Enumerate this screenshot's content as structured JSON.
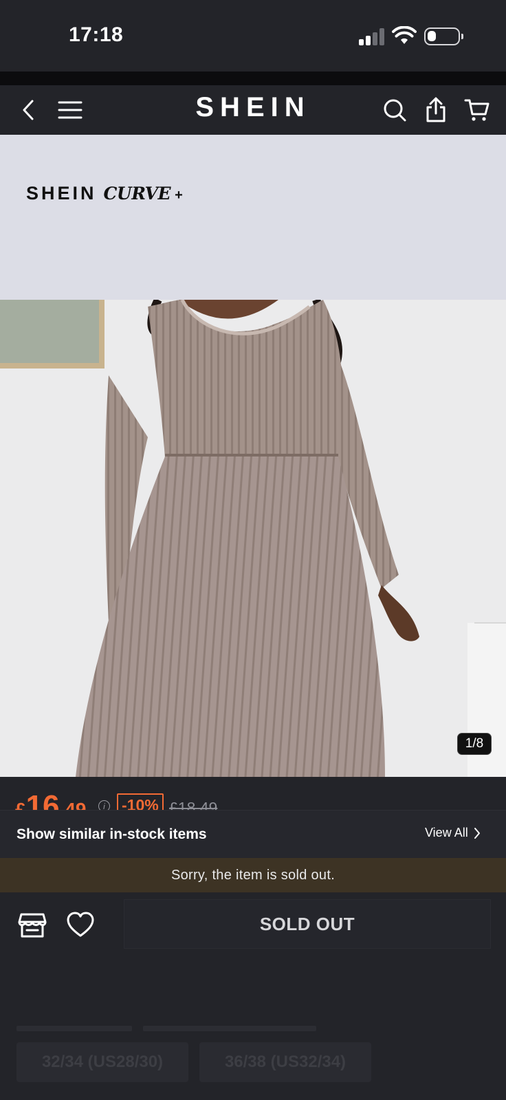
{
  "status_bar": {
    "time": "17:18",
    "battery_level": 0.3
  },
  "nav": {
    "brand": "SHEIN",
    "icons": [
      "back-arrow-icon",
      "menu-icon",
      "search-icon",
      "share-icon",
      "cart-icon"
    ]
  },
  "banner": {
    "brand": "SHEIN",
    "line": "CURVE",
    "plus": "+"
  },
  "gallery": {
    "counter": "1/8"
  },
  "price": {
    "currency": "£",
    "integer": "16",
    "decimal": ".49",
    "discount": "-10%",
    "original": "£18.49",
    "color": "#f26a34"
  },
  "similar": {
    "title": "Show similar in-stock items",
    "view_all": "View All"
  },
  "notice": {
    "text": "Sorry, the item is sold out."
  },
  "actions": {
    "sold_out": "SOLD OUT"
  },
  "sizes": [
    "32/34 (US28/30)",
    "36/38 (US32/34)"
  ]
}
